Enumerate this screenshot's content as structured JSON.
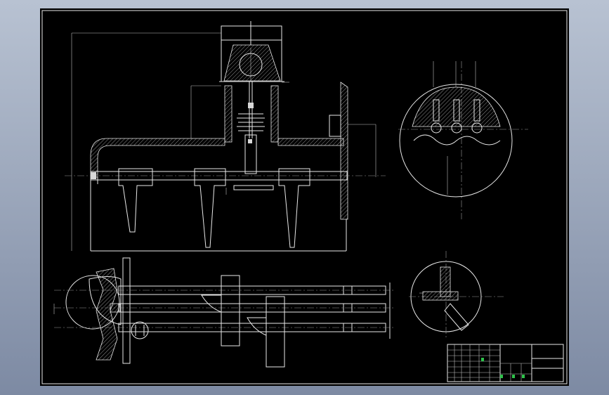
{
  "title_block": {
    "row1": [
      "",
      "",
      "",
      "",
      "",
      ""
    ],
    "mid_label": "",
    "big_label": "",
    "sub_label": ""
  },
  "colors": {
    "background": "#000000",
    "lines": "#e8e8e8",
    "accent": "#2ec24a"
  }
}
